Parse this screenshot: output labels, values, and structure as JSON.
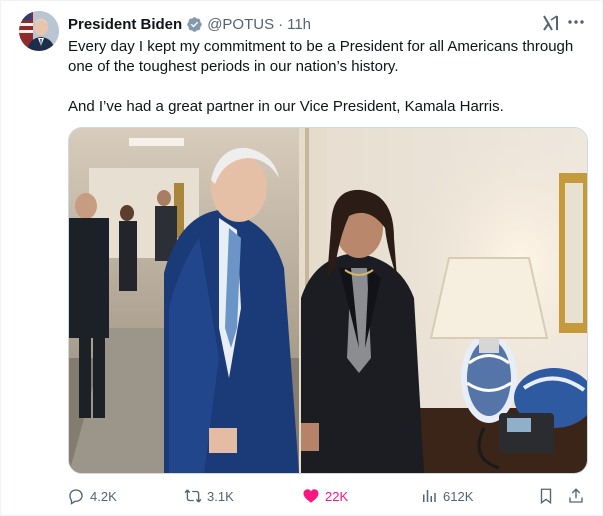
{
  "tweet": {
    "author_name": "President Biden",
    "handle": "@POTUS",
    "separator": "·",
    "time": "11h",
    "verified_icon": "verified-badge-icon",
    "text_line_1": "Every day I kept my commitment to be a President for all Americans through one of the toughest periods in our nation’s history.",
    "text_line_2": "And I’ve had a great partner in our Vice President, Kamala Harris."
  },
  "actions": {
    "replies": "4.2K",
    "reposts": "3.1K",
    "likes": "22K",
    "views": "612K"
  },
  "colors": {
    "text": "#0f1419",
    "muted": "#536471",
    "like": "#f91880",
    "verified": "#829aab"
  },
  "icons": [
    "grok-icon",
    "more-icon",
    "reply-icon",
    "repost-icon",
    "heart-icon",
    "views-icon",
    "bookmark-icon",
    "share-icon"
  ]
}
